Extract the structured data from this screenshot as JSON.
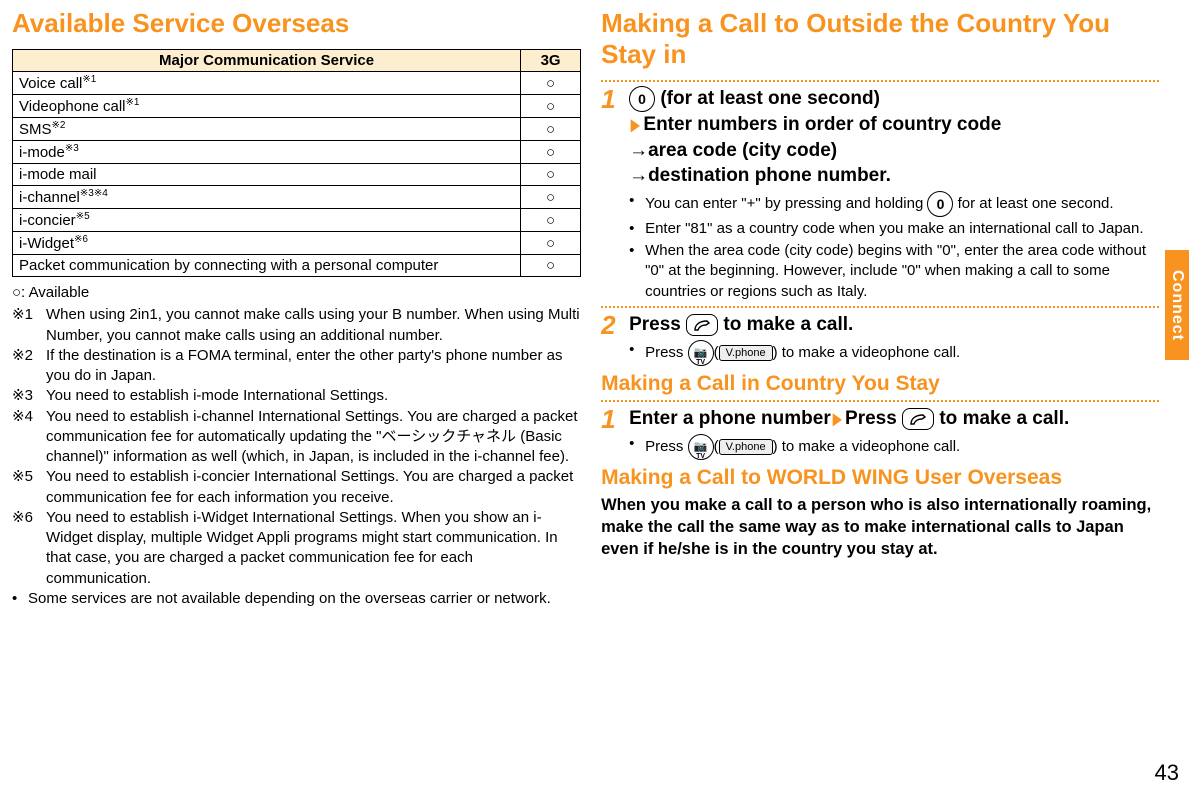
{
  "sideTab": "Connect",
  "pageNumber": "43",
  "left": {
    "heading": "Available Service Overseas",
    "table": {
      "headers": [
        "Major Communication Service",
        "3G"
      ],
      "rows": [
        {
          "service": "Voice call",
          "sup": "※1",
          "mark": "○"
        },
        {
          "service": "Videophone call",
          "sup": "※1",
          "mark": "○"
        },
        {
          "service": "SMS",
          "sup": "※2",
          "mark": "○"
        },
        {
          "service": "i-mode",
          "sup": "※3",
          "mark": "○"
        },
        {
          "service": "i-mode mail",
          "sup": "",
          "mark": "○"
        },
        {
          "service": "i-channel",
          "sup": "※3※4",
          "mark": "○"
        },
        {
          "service": "i-concier",
          "sup": "※5",
          "mark": "○"
        },
        {
          "service": "i-Widget",
          "sup": "※6",
          "mark": "○"
        },
        {
          "service": "Packet communication by connecting with a personal computer",
          "sup": "",
          "mark": "○"
        }
      ]
    },
    "legend": "○: Available",
    "footnotes": [
      {
        "label": "※1",
        "text": "When using 2in1, you cannot make calls using your B number. When using Multi Number, you cannot make calls using an additional number."
      },
      {
        "label": "※2",
        "text": "If the destination is a FOMA terminal, enter the other party's phone number as you do in Japan."
      },
      {
        "label": "※3",
        "text": "You need to establish i-mode International Settings."
      },
      {
        "label": "※4",
        "text": "You need to establish i-channel International Settings. You are charged a packet communication fee for automatically updating the \"ベーシックチャネル (Basic channel)\" information as well (which, in Japan, is included in the i-channel fee)."
      },
      {
        "label": "※5",
        "text": "You need to establish i-concier International Settings. You are charged a packet communication fee for each information you receive."
      },
      {
        "label": "※6",
        "text": "You need to establish i-Widget International Settings. When you show an i-Widget display, multiple Widget Appli programs might start communication. In that case, you are charged a packet communication fee for each communication."
      }
    ],
    "extraBullet": "Some services are not available depending on the overseas carrier or network."
  },
  "right": {
    "heading1": "Making a Call to Outside the Country You Stay in",
    "step1": {
      "num": "1",
      "key": "0",
      "afterKey": " (for at least one second)",
      "line2a": "Enter numbers in order of country code",
      "line2b": "→area code (city code)",
      "line2c": "→destination phone number.",
      "notes": [
        "You can enter \"+\" by pressing and holding ",
        "Enter \"81\" as a country code when you make an international call to Japan.",
        "When the area code (city code) begins with \"0\", enter the area code without \"0\" at the beginning. However, include \"0\" when making a call to some countries or regions such as Italy."
      ],
      "note1suffix": " for at least one second.",
      "note1key": "0"
    },
    "step2": {
      "num": "2",
      "pre": "Press ",
      "post": " to make a call.",
      "note": "Press ",
      "noteMid": "(",
      "notePill": "V.phone",
      "noteEnd": ") to make a videophone call.",
      "cameraIcon": "📷"
    },
    "heading2": "Making a Call in Country You Stay",
    "stayStep": {
      "num": "1",
      "textA": "Enter a phone number",
      "textB": "Press ",
      "textC": " to make a call.",
      "note": "Press ",
      "noteMid": "(",
      "notePill": "V.phone",
      "noteEnd": ") to make a videophone call."
    },
    "heading3": "Making a Call to WORLD WING User Overseas",
    "para3": "When you make a call to a person who is also internationally roaming, make the call the same way as to make international calls to Japan even if he/she is in the country you stay at."
  }
}
